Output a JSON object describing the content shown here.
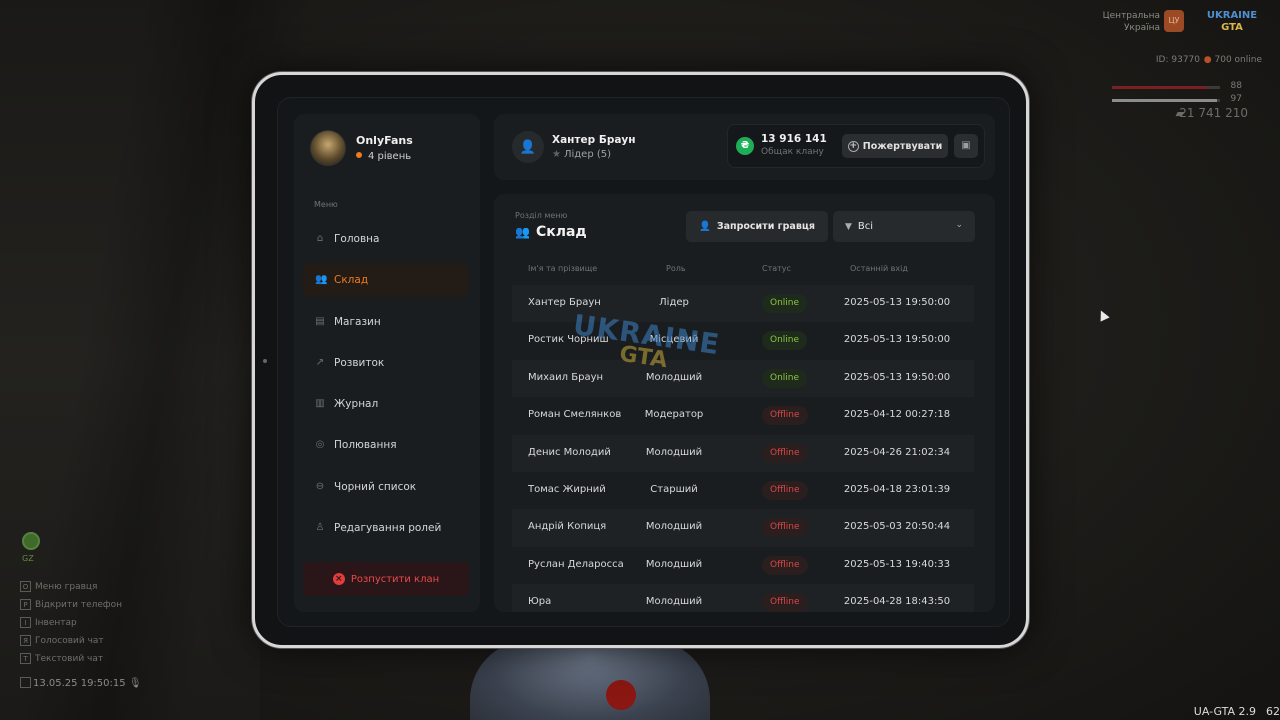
{
  "hud": {
    "region_line1": "Центральна",
    "region_line2": "Україна",
    "region_badge": "ЦУ",
    "logo_top": "UKRAINE",
    "logo_bottom": "GTA",
    "player_id": "ID: 93770",
    "online": "700 online",
    "health": "88",
    "armor": "97",
    "money": "21 741 210",
    "gps_label": "GZ",
    "hints": [
      {
        "key": "O",
        "label": "Меню гравця"
      },
      {
        "key": "P",
        "label": "Відкрити телефон"
      },
      {
        "key": "I",
        "label": "Інвентар"
      },
      {
        "key": "Я",
        "label": "Голосовий чат"
      },
      {
        "key": "T",
        "label": "Текстовий чат"
      }
    ],
    "datetime": "13.05.25 19:50:15",
    "version": "UA-GTA 2.9",
    "fps": "62"
  },
  "sidebar": {
    "clan_name": "OnlyFans",
    "clan_level": "4 рівень",
    "menu_title": "Меню",
    "items": [
      {
        "label": "Головна",
        "icon": "home-icon"
      },
      {
        "label": "Склад",
        "icon": "people-icon"
      },
      {
        "label": "Магазин",
        "icon": "shop-icon"
      },
      {
        "label": "Розвиток",
        "icon": "chart-icon"
      },
      {
        "label": "Журнал",
        "icon": "book-icon"
      },
      {
        "label": "Полювання",
        "icon": "target-icon"
      },
      {
        "label": "Чорний список",
        "icon": "block-icon"
      },
      {
        "label": "Редагування ролей",
        "icon": "user-edit-icon"
      }
    ],
    "active_index": 1,
    "disband_label": "Розпустити клан"
  },
  "topbar": {
    "user_name": "Хантер Браун",
    "user_role": "Лідер (5)",
    "fund_amount": "13 916 141",
    "fund_label": "Общак клану",
    "donate_label": "Пожертвувати"
  },
  "main": {
    "section_sub": "Розділ меню",
    "section_title": "Склад",
    "invite_label": "Запросити гравця",
    "filter_value": "Всі",
    "columns": {
      "name": "Ім'я та прізвище",
      "role": "Роль",
      "status": "Статус",
      "last": "Останній вхід"
    },
    "members": [
      {
        "name": "Хантер Браун",
        "role": "Лідер",
        "status": "Online",
        "last": "2025-05-13 19:50:00"
      },
      {
        "name": "Ростик Чорниш",
        "role": "Місцевий",
        "status": "Online",
        "last": "2025-05-13 19:50:00"
      },
      {
        "name": "Михаил Браун",
        "role": "Молодший",
        "status": "Online",
        "last": "2025-05-13 19:50:00"
      },
      {
        "name": "Роман Смелянков",
        "role": "Модератор",
        "status": "Offline",
        "last": "2025-04-12 00:27:18"
      },
      {
        "name": "Денис Молодий",
        "role": "Молодший",
        "status": "Offline",
        "last": "2025-04-26 21:02:34"
      },
      {
        "name": "Томас Жирний",
        "role": "Старший",
        "status": "Offline",
        "last": "2025-04-18 23:01:39"
      },
      {
        "name": "Андрій Копиця",
        "role": "Молодший",
        "status": "Offline",
        "last": "2025-05-03 20:50:44"
      },
      {
        "name": "Руслан Деларосса",
        "role": "Молодший",
        "status": "Offline",
        "last": "2025-05-13 19:40:33"
      },
      {
        "name": "Юра",
        "role": "Молодший",
        "status": "Offline",
        "last": "2025-04-28 18:43:50"
      }
    ]
  },
  "watermark": {
    "top": "UKRAINE",
    "bottom": "GTA"
  }
}
